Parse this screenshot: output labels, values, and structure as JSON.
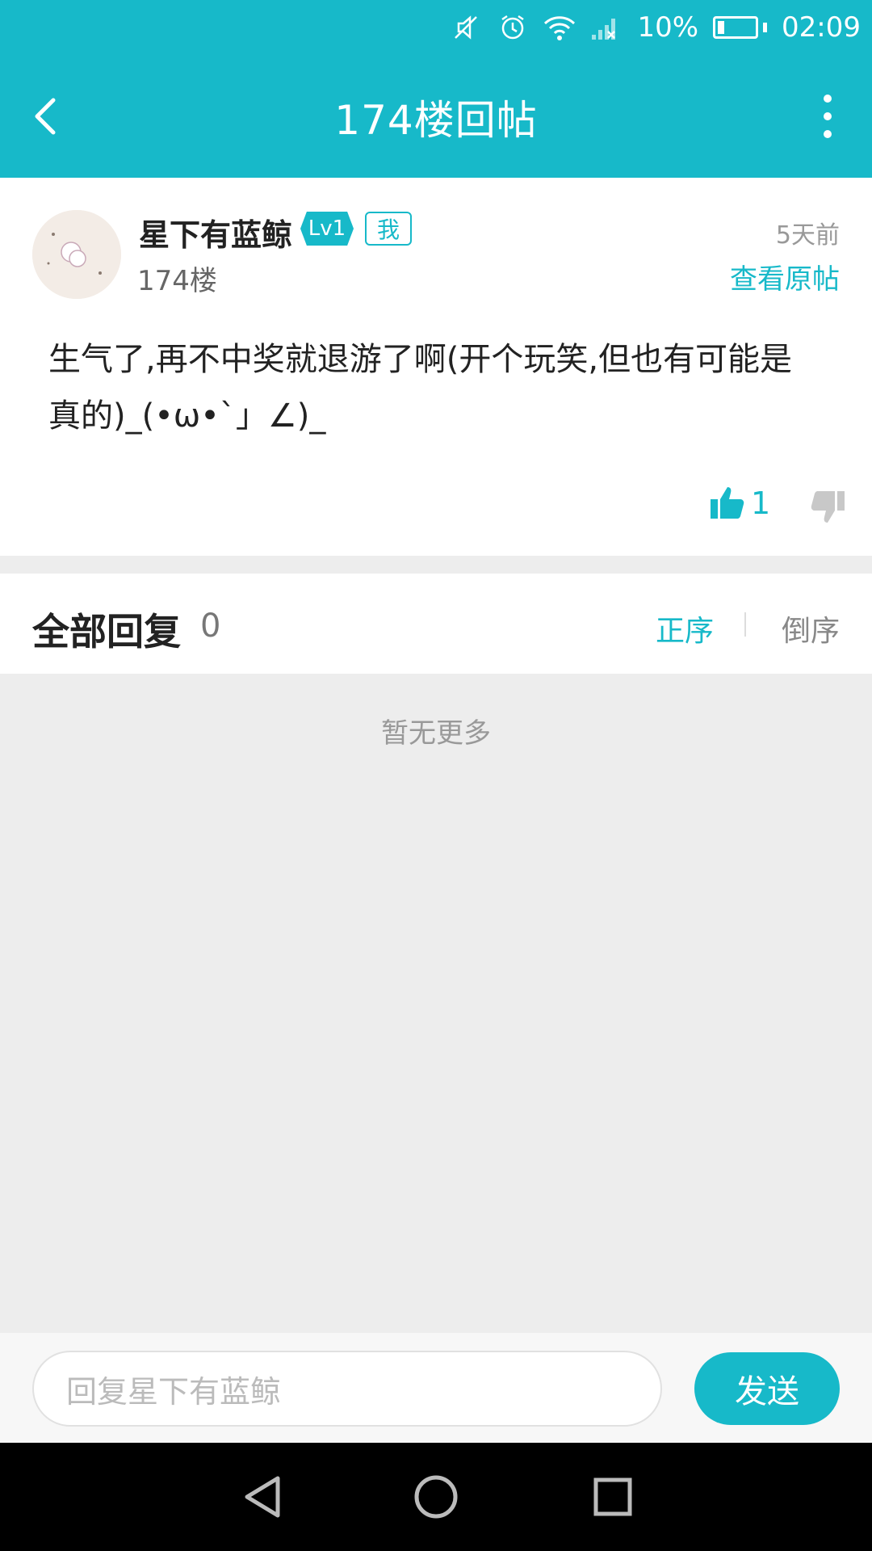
{
  "status_bar": {
    "battery": "10%",
    "time": "02:09",
    "icons": [
      "mute-icon",
      "alarm-icon",
      "wifi-icon",
      "signal-icon",
      "battery-icon"
    ]
  },
  "header": {
    "title": "174楼回帖",
    "back_icon": "chevron-left-icon",
    "more_icon": "more-vertical-icon"
  },
  "post": {
    "username": "星下有蓝鲸",
    "level": "Lv1",
    "me_tag": "我",
    "floor": "174楼",
    "time_ago": "5天前",
    "view_original": "查看原帖",
    "content": "生气了,再不中奖就退游了啊(开个玩笑,但也有可能是真的)_(•ω•`」∠)_",
    "likes": "1"
  },
  "replies": {
    "title": "全部回复",
    "count": "0",
    "sort_asc": "正序",
    "sort_desc": "倒序",
    "empty": "暂无更多"
  },
  "reply_bar": {
    "placeholder": "回复星下有蓝鲸",
    "send": "发送"
  },
  "colors": {
    "accent": "#17b9c9",
    "background": "#ededed"
  }
}
